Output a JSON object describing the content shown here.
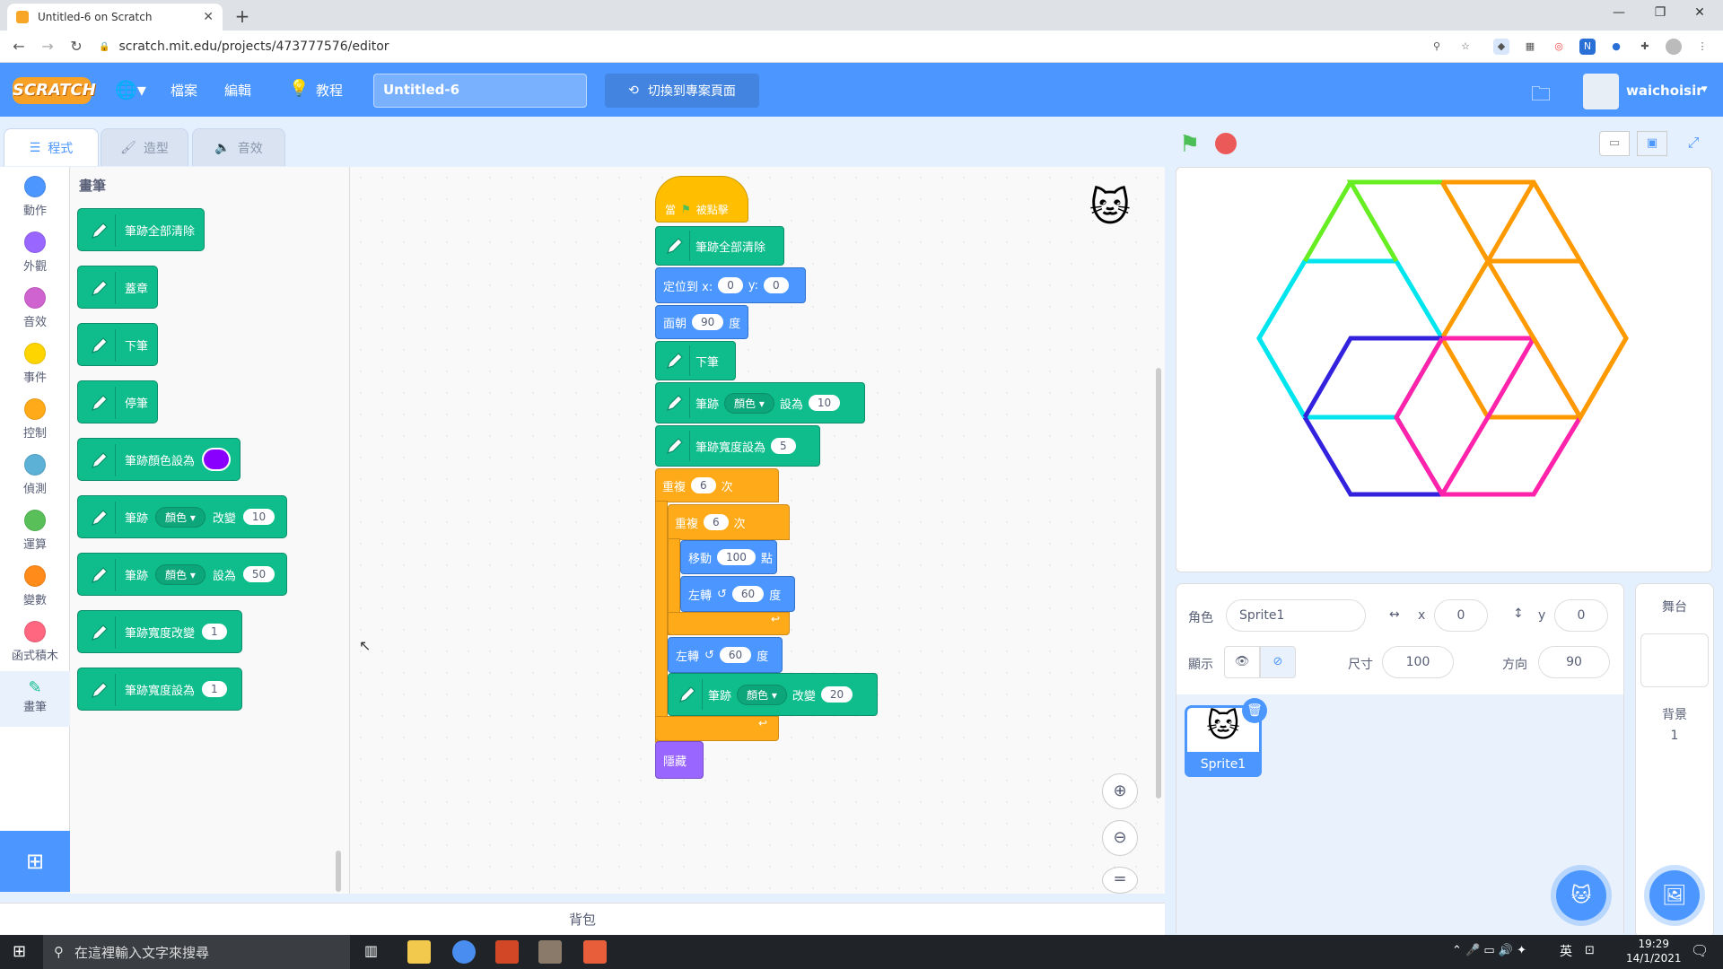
{
  "browser": {
    "tab_title": "Untitled-6 on Scratch",
    "url": "scratch.mit.edu/projects/473777576/editor"
  },
  "menubar": {
    "logo": "SCRATCH",
    "file": "檔案",
    "edit": "編輯",
    "tutorials": "教程",
    "project_title": "Untitled-6",
    "see_project": "切換到專案頁面",
    "username": "waichoisir"
  },
  "editor_tabs": [
    "程式",
    "造型",
    "音效"
  ],
  "categories": [
    {
      "label": "動作",
      "color": "#4c97ff"
    },
    {
      "label": "外觀",
      "color": "#9966ff"
    },
    {
      "label": "音效",
      "color": "#cf63cf"
    },
    {
      "label": "事件",
      "color": "#ffd500"
    },
    {
      "label": "控制",
      "color": "#ffab19"
    },
    {
      "label": "偵測",
      "color": "#5cb1d6"
    },
    {
      "label": "運算",
      "color": "#59c059"
    },
    {
      "label": "變數",
      "color": "#ff8c1a"
    },
    {
      "label": "函式積木",
      "color": "#ff6680"
    },
    {
      "label": "畫筆",
      "color": "#0fbd8c"
    }
  ],
  "palette": {
    "heading": "畫筆",
    "blocks": {
      "clear": "筆跡全部清除",
      "stamp": "蓋章",
      "pen_down": "下筆",
      "pen_up": "停筆",
      "set_color_to": "筆跡顏色設為",
      "change_by_pre": "筆跡",
      "color_dd": "顏色",
      "change_by": "改變",
      "change_val": "10",
      "set_to_pre": "筆跡",
      "set_to": "設為",
      "set_val": "50",
      "change_size": "筆跡寬度改變",
      "change_size_val": "1",
      "set_size": "筆跡寬度設為",
      "set_size_val": "1"
    }
  },
  "script": {
    "when_flag_pre": "當",
    "when_flag_post": "被點擊",
    "clear": "筆跡全部清除",
    "goto": "定位到 x:",
    "goto_x": "0",
    "goto_y_lbl": "y:",
    "goto_y": "0",
    "point_dir": "面朝",
    "point_val": "90",
    "deg": "度",
    "pen_down": "下筆",
    "set_pen_pre": "筆跡",
    "color_dd": "顏色",
    "set_word": "設為",
    "set_pen_val": "10",
    "set_size": "筆跡寬度設為",
    "set_size_val": "5",
    "repeat": "重複",
    "repeat1_val": "6",
    "times": "次",
    "repeat2_val": "6",
    "move": "移動",
    "move_val": "100",
    "steps": "點",
    "turn_left": "左轉",
    "turn_val": "60",
    "turn2_val": "60",
    "change_word": "改變",
    "change_val": "20",
    "hide": "隱藏"
  },
  "backpack": "背包",
  "sprite_info": {
    "sprite_label": "角色",
    "sprite_name": "Sprite1",
    "x_label": "x",
    "x": "0",
    "y_label": "y",
    "y": "0",
    "show_label": "顯示",
    "size_label": "尺寸",
    "size": "100",
    "direction_label": "方向",
    "direction": "90"
  },
  "sprites": [
    {
      "name": "Sprite1"
    }
  ],
  "stage_panel": {
    "title": "舞台",
    "backdrops_label": "背景",
    "backdrop_count": "1"
  },
  "taskbar": {
    "search_placeholder": "在這裡輸入文字來搜尋",
    "ime": "英",
    "time": "19:29",
    "date": "14/1/2021"
  },
  "colors": {
    "scratch_blue": "#4c97ff",
    "pen_green": "#0fbd8c",
    "control_orange": "#ffab19"
  }
}
